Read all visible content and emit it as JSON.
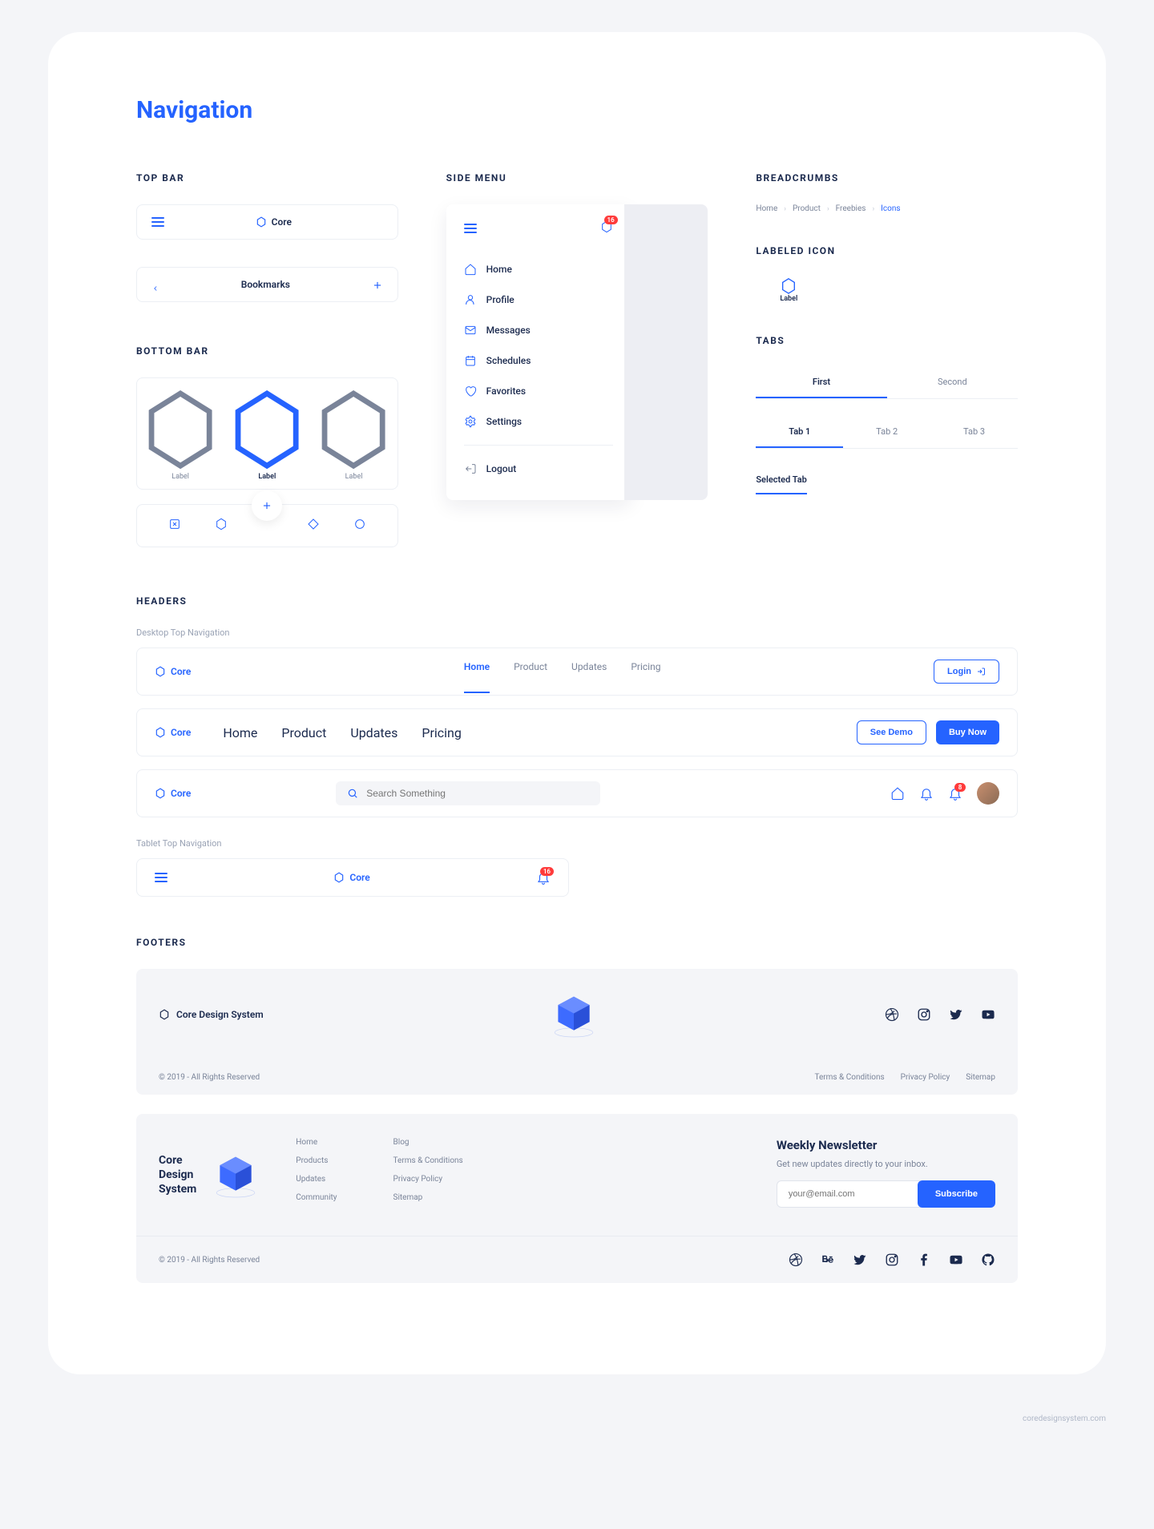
{
  "page_title": "Navigation",
  "sections": {
    "top_bar": "TOP BAR",
    "bottom_bar": "BOTTOM BAR",
    "side_menu": "SIDE MENU",
    "breadcrumbs": "BREADCRUMBS",
    "labeled_icon": "LABELED ICON",
    "tabs": "TABS",
    "headers": "HEADERS",
    "footers": "FOOTERS"
  },
  "topbar": {
    "brand": "Core",
    "bookmarks": "Bookmarks"
  },
  "bottombar": {
    "items": [
      {
        "label": "Label"
      },
      {
        "label": "Label"
      },
      {
        "label": "Label"
      }
    ]
  },
  "sidemenu": {
    "badge": "16",
    "items": [
      {
        "label": "Home",
        "icon": "home-icon"
      },
      {
        "label": "Profile",
        "icon": "user-icon"
      },
      {
        "label": "Messages",
        "icon": "mail-icon"
      },
      {
        "label": "Schedules",
        "icon": "calendar-icon"
      },
      {
        "label": "Favorites",
        "icon": "heart-icon"
      },
      {
        "label": "Settings",
        "icon": "gear-icon"
      }
    ],
    "logout": "Logout"
  },
  "breadcrumb": {
    "items": [
      "Home",
      "Product",
      "Freebies"
    ],
    "current": "Icons"
  },
  "labeled_icon": {
    "label": "Label"
  },
  "tabs": {
    "two": [
      "First",
      "Second"
    ],
    "three": [
      "Tab 1",
      "Tab 2",
      "Tab 3"
    ],
    "selected": "Selected Tab"
  },
  "headers": {
    "desktop_label": "Desktop Top Navigation",
    "tablet_label": "Tablet Top Navigation",
    "brand": "Core",
    "nav": [
      "Home",
      "Product",
      "Updates",
      "Pricing"
    ],
    "login": "Login",
    "see_demo": "See Demo",
    "buy_now": "Buy Now",
    "search_placeholder": "Search Something",
    "tablet_badge": "16",
    "bell_badge": "8"
  },
  "footers": {
    "brand_full": "Core Design System",
    "brand_line1": "Core",
    "brand_line2": "Design",
    "brand_line3": "System",
    "copyright": "© 2019 - All Rights Reserved",
    "links1": [
      "Terms & Conditions",
      "Privacy Policy",
      "Sitemap"
    ],
    "col1": [
      "Home",
      "Products",
      "Updates",
      "Community"
    ],
    "col2": [
      "Blog",
      "Terms & Conditions",
      "Privacy Policy",
      "Sitemap"
    ],
    "newsletter_title": "Weekly Newsletter",
    "newsletter_sub": "Get new updates directly to your inbox.",
    "email_placeholder": "your@email.com",
    "subscribe": "Subscribe"
  },
  "watermark": "coredesignsystem.com",
  "colors": {
    "accent": "#2563ff",
    "danger": "#ff3b3b",
    "muted": "#7a8499"
  }
}
